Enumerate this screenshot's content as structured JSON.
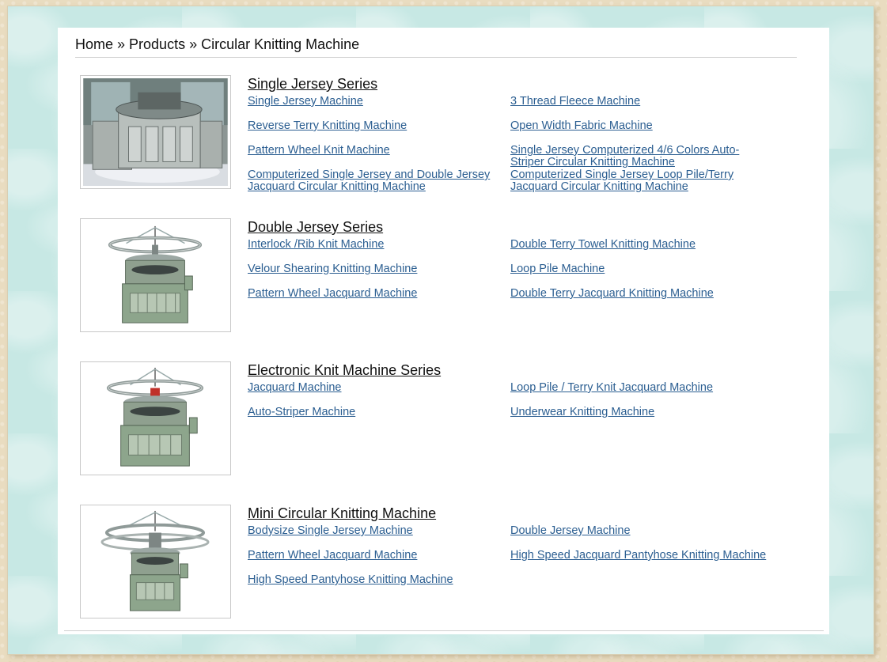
{
  "breadcrumb": {
    "home": "Home",
    "separator": "»",
    "products": "Products",
    "current": "Circular Knitting Machine"
  },
  "colors": {
    "link": "#2b5e91",
    "frame": "#c7e8e4",
    "outer": "#e9dcc0"
  },
  "series": [
    {
      "title": "Single Jersey Series",
      "image_icon": "single-jersey-machine-photo",
      "links": [
        "Single Jersey Machine",
        "3 Thread Fleece Machine",
        "Reverse Terry Knitting Machine",
        "Open Width Fabric Machine",
        "Pattern Wheel Knit Machine",
        "Single Jersey Computerized 4/6 Colors Auto-Striper Circular Knitting Machine",
        "Computerized Single Jersey and Double Jersey Jacquard Circular Knitting Machine",
        "Computerized Single Jersey Loop Pile/Terry Jacquard Circular Knitting Machine"
      ]
    },
    {
      "title": "Double Jersey Series",
      "image_icon": "double-jersey-machine-photo",
      "links": [
        "Interlock /Rib Knit Machine",
        "Double Terry Towel Knitting Machine",
        "Velour Shearing Knitting Machine",
        "Loop Pile Machine",
        "Pattern Wheel Jacquard Machine",
        "Double Terry Jacquard Knitting Machine"
      ]
    },
    {
      "title": "Electronic Knit Machine Series",
      "image_icon": "electronic-knit-machine-photo",
      "links": [
        "Jacquard Machine",
        "Loop Pile / Terry Knit Jacquard Machine",
        "Auto-Striper Machine",
        "Underwear Knitting Machine"
      ]
    },
    {
      "title": "Mini Circular Knitting Machine",
      "image_icon": "mini-circular-machine-photo",
      "links": [
        "Bodysize Single Jersey Machine",
        "Double Jersey Machine",
        "Pattern Wheel Jacquard Machine",
        "High Speed Jacquard Pantyhose Knitting Machine",
        "High Speed Pantyhose Knitting Machine"
      ]
    }
  ]
}
